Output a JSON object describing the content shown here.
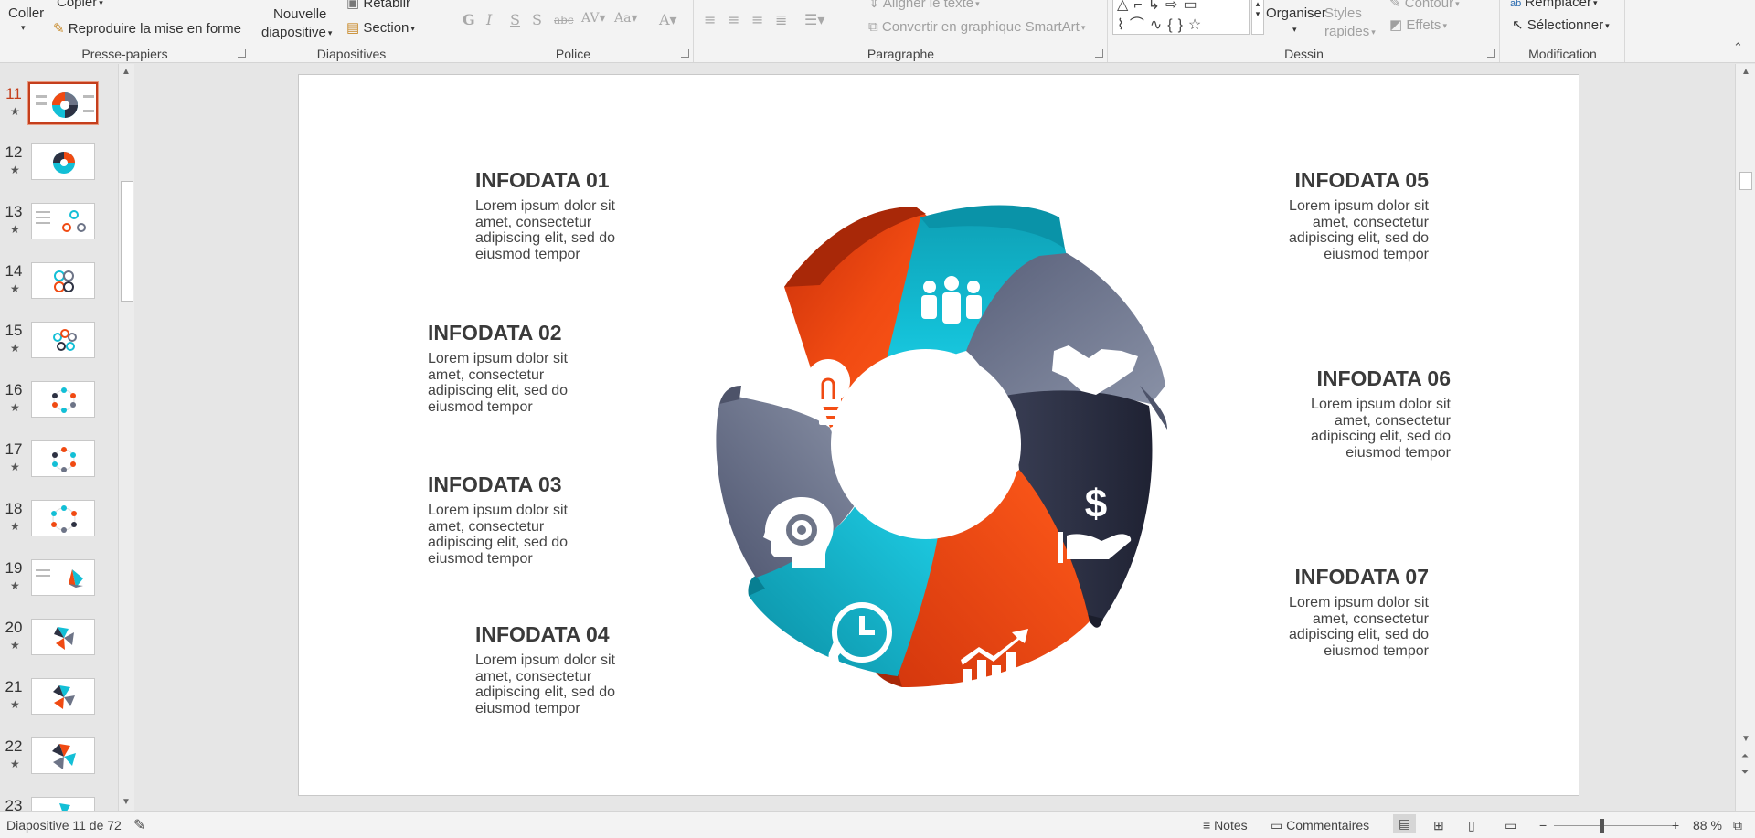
{
  "ribbon": {
    "clipboard": {
      "paste": "Coller",
      "copy": "Copier",
      "format_painter": "Reproduire la mise en forme",
      "label": "Presse-papiers"
    },
    "slides": {
      "new_slide_line1": "Nouvelle",
      "new_slide_line2": "diapositive",
      "reset": "Rétablir",
      "section": "Section",
      "label": "Diapositives"
    },
    "font": {
      "label": "Police"
    },
    "paragraph": {
      "align_text": "Aligner le texte",
      "convert_smartart": "Convertir en graphique SmartArt",
      "label": "Paragraphe"
    },
    "drawing": {
      "arrange": "Organiser",
      "quick_styles_line1": "Styles",
      "quick_styles_line2": "rapides",
      "outline": "Contour",
      "effects": "Effets",
      "label": "Dessin"
    },
    "editing": {
      "replace": "Remplacer",
      "select": "Sélectionner",
      "label": "Modification"
    }
  },
  "thumbnails": [
    {
      "num": "11",
      "active": true
    },
    {
      "num": "12"
    },
    {
      "num": "13"
    },
    {
      "num": "14"
    },
    {
      "num": "15"
    },
    {
      "num": "16"
    },
    {
      "num": "17"
    },
    {
      "num": "18"
    },
    {
      "num": "19"
    },
    {
      "num": "20"
    },
    {
      "num": "21"
    },
    {
      "num": "22"
    },
    {
      "num": "23"
    }
  ],
  "slide": {
    "items": [
      {
        "title": "INFODATA 01",
        "text": "Lorem ipsum dolor sit amet, consectetur adipiscing elit, sed do eiusmod tempor"
      },
      {
        "title": "INFODATA 02",
        "text": "Lorem ipsum dolor sit amet, consectetur adipiscing elit, sed do eiusmod tempor"
      },
      {
        "title": "INFODATA 03",
        "text": "Lorem ipsum dolor sit amet, consectetur adipiscing elit, sed do eiusmod tempor"
      },
      {
        "title": "INFODATA 04",
        "text": "Lorem ipsum dolor sit amet, consectetur adipiscing elit, sed do eiusmod tempor"
      },
      {
        "title": "INFODATA 05",
        "text": "Lorem ipsum dolor sit amet, consectetur adipiscing elit, sed do eiusmod tempor"
      },
      {
        "title": "INFODATA 06",
        "text": "Lorem ipsum dolor sit amet, consectetur adipiscing elit, sed do eiusmod tempor"
      },
      {
        "title": "INFODATA 07",
        "text": "Lorem ipsum dolor sit amet, consectetur adipiscing elit, sed do eiusmod tempor"
      }
    ],
    "icons": [
      "people-icon",
      "handshake-icon",
      "dollar-hand-icon",
      "growth-chart-icon",
      "clock-phone-icon",
      "head-gear-icon",
      "lightbulb-icon"
    ],
    "colors": {
      "orange": "#f04a12",
      "cyan": "#13bfd6",
      "slate": "#6d7487",
      "navy": "#2d3142"
    }
  },
  "status": {
    "slide_position": "Diapositive 11 de 72",
    "notes": "Notes",
    "comments": "Commentaires",
    "zoom": "88 %"
  }
}
